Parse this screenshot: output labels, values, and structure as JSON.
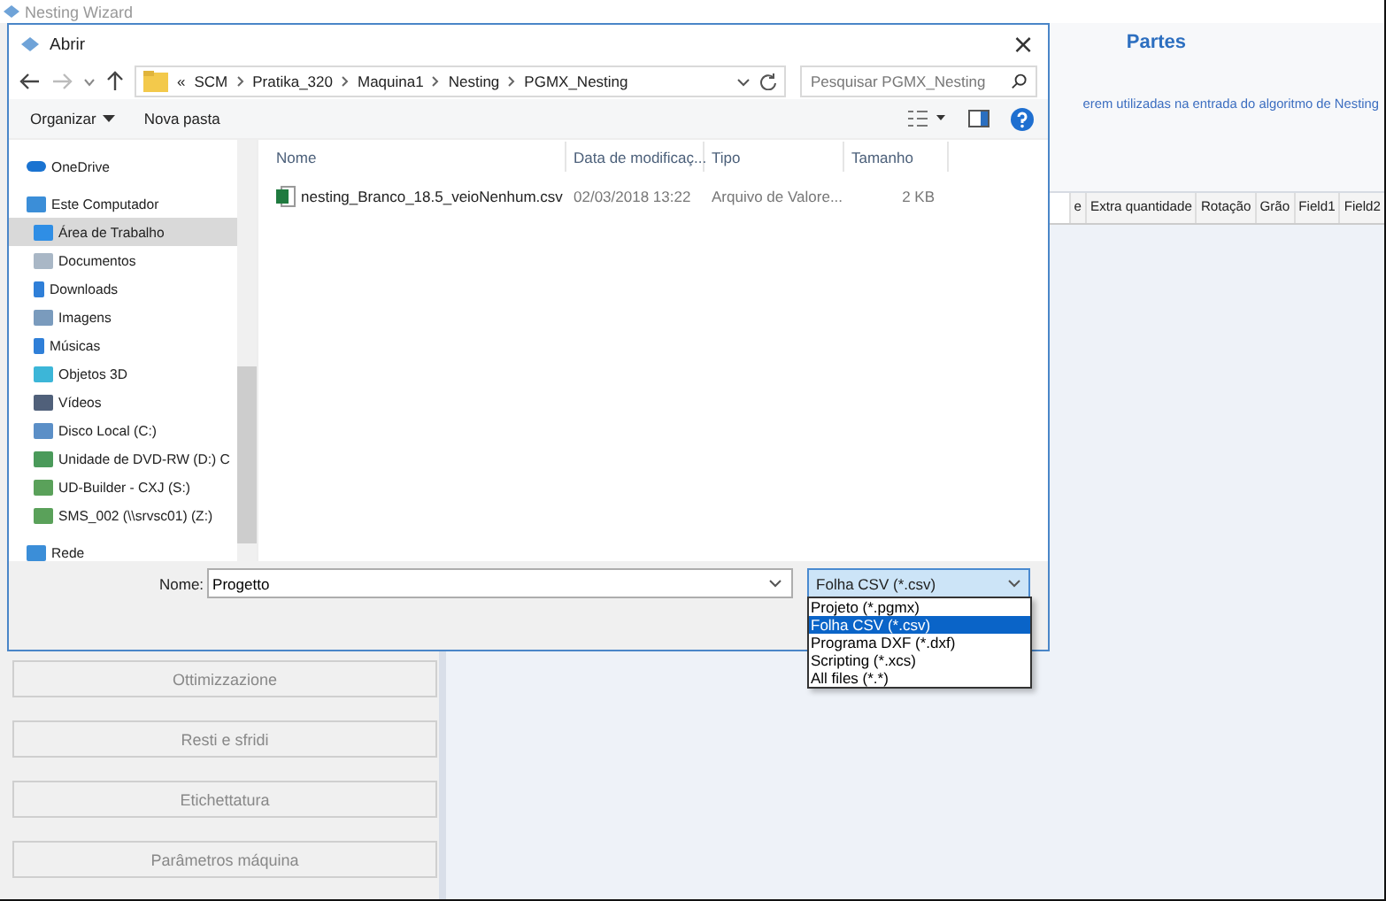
{
  "window": {
    "title": "Nesting Wizard"
  },
  "side_buttons": [
    {
      "label": "Ottimizzazione"
    },
    {
      "label": "Resti e sfridi"
    },
    {
      "label": "Etichettatura"
    },
    {
      "label": "Parâmetros máquina"
    }
  ],
  "panel": {
    "title": "Partes",
    "subtitle": "erem utilizadas na entrada do algoritmo de Nesting",
    "columns": [
      "e",
      "Extra quantidade",
      "Rotação",
      "Grão",
      "Field1",
      "Field2"
    ]
  },
  "dialog": {
    "title": "Abrir",
    "close": "×",
    "breadcrumb": [
      "«",
      "SCM",
      "Pratika_320",
      "Maquina1",
      "Nesting",
      "PGMX_Nesting"
    ],
    "search": {
      "placeholder": "Pesquisar PGMX_Nesting"
    },
    "toolbar": [
      "Organizar",
      "Nova pasta"
    ],
    "nav": [
      {
        "label": "OneDrive",
        "kind": "cloud",
        "selected": false
      },
      {
        "label": "Este Computador",
        "kind": "computer",
        "selected": false,
        "children": [
          {
            "label": "Área de Trabalho",
            "kind": "desktop",
            "selected": true
          },
          {
            "label": "Documentos",
            "kind": "documents",
            "selected": false
          },
          {
            "label": "Downloads",
            "kind": "downloads",
            "selected": false
          },
          {
            "label": "Imagens",
            "kind": "pictures",
            "selected": false
          },
          {
            "label": "Músicas",
            "kind": "music",
            "selected": false
          },
          {
            "label": "Objetos 3D",
            "kind": "objects",
            "selected": false
          },
          {
            "label": "Vídeos",
            "kind": "videos",
            "selected": false
          },
          {
            "label": "Disco Local (C:)",
            "kind": "disk",
            "selected": false
          },
          {
            "label": "Unidade de DVD-RW (D:) C",
            "kind": "dvd",
            "selected": false
          },
          {
            "label": "UD-Builder - CXJ (S:)",
            "kind": "netdrive",
            "selected": false
          },
          {
            "label": "SMS_002 (\\\\srvsc01) (Z:)",
            "kind": "netdrive",
            "selected": false
          }
        ]
      },
      {
        "label": "Rede",
        "kind": "network",
        "selected": false
      }
    ],
    "columns": [
      "Nome",
      "Data de modificaç...",
      "Tipo",
      "Tamanho"
    ],
    "files": [
      {
        "name": "nesting_Branco_18.5_veioNenhum.csv",
        "modified": "02/03/2018 13:22",
        "type": "Arquivo de Valore...",
        "size": "2 KB"
      }
    ],
    "filename_label": "Nome:",
    "filename": "Progetto",
    "filetype": "Folha CSV (*.csv)",
    "filetype_options": [
      {
        "label": "Projeto (*.pgmx)",
        "selected": false
      },
      {
        "label": "Folha CSV (*.csv)",
        "selected": true
      },
      {
        "label": "Programa DXF (*.dxf)",
        "selected": false
      },
      {
        "label": "Scripting (*.xcs)",
        "selected": false
      },
      {
        "label": "All files (*.*)",
        "selected": false
      }
    ]
  }
}
